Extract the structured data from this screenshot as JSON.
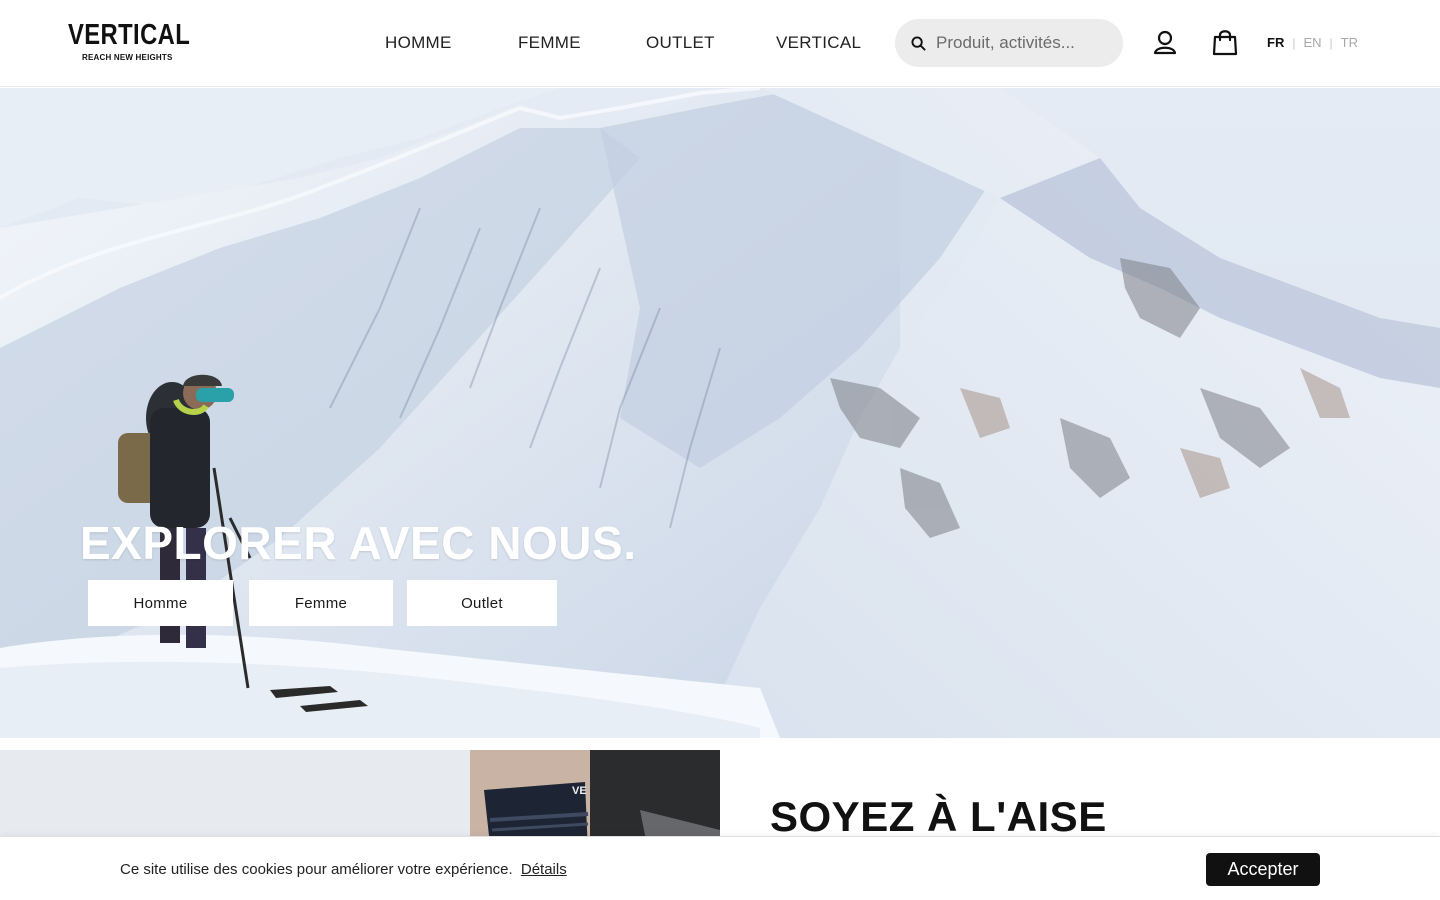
{
  "brand": {
    "name": "VERTICAL",
    "tagline": "REACH NEW HEIGHTS"
  },
  "nav": {
    "items": [
      "HOMME",
      "FEMME",
      "OUTLET",
      "VERTICAL"
    ]
  },
  "search": {
    "placeholder": "Produit, activités..."
  },
  "icons": {
    "account": "user-icon",
    "cart": "shopping-bag-icon",
    "search": "search-icon"
  },
  "languages": {
    "items": [
      "FR",
      "EN",
      "TR"
    ],
    "active": "FR"
  },
  "hero": {
    "title": "EXPLORER AVEC NOUS.",
    "buttons": [
      "Homme",
      "Femme",
      "Outlet"
    ]
  },
  "promo": {
    "heading": "SOYEZ À L'AISE"
  },
  "cookie": {
    "text": "Ce site utilise des cookies pour améliorer votre expérience.",
    "link": "Détails",
    "accept": "Accepter"
  },
  "colors": {
    "accent": "#111111",
    "search_bg": "#ececec",
    "inactive_lang": "#a8a8a8"
  }
}
